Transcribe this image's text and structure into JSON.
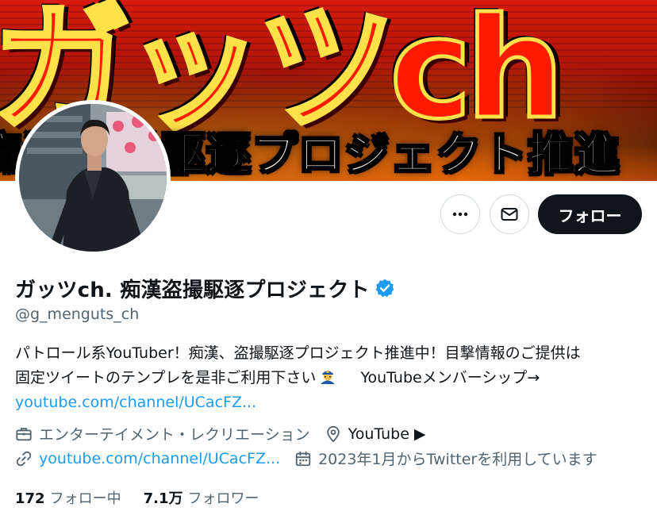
{
  "banner": {
    "headline": "ガッツch",
    "subline": "痴漢盗撮駆逐プロジェクト推進"
  },
  "profile": {
    "display_name": "ガッツch. 痴漢盗撮駆逐プロジェクト",
    "handle": "@g_menguts_ch",
    "verified": true,
    "bio_line1": "パトロール系YouTuber！痴漢、盗撮駆逐プロジェクト推進中！目撃情報のご提供は",
    "bio_line2_pre": "固定ツイートのテンプレを是非ご利用下さい",
    "bio_line2_emoji": "man-police-officer-emoji",
    "bio_line2_post": "YouTubeメンバーシップ→",
    "bio_link": "youtube.com/channel/UCacFZ...",
    "category": "エンターテイメント・レクリエーション",
    "location": "YouTube ▶",
    "website": "youtube.com/channel/UCacFZ...",
    "joined": "2023年1月からTwitterを利用しています",
    "following_count": "172",
    "following_label": "フォロー中",
    "followers_count": "7.1万",
    "followers_label": "フォロワー"
  },
  "actions": {
    "more_icon": "ellipsis-icon",
    "message_icon": "envelope-icon",
    "follow_label": "フォロー"
  },
  "colors": {
    "accent": "#1d9bf0",
    "text_primary": "#0f1419",
    "text_secondary": "#536471",
    "follow_button_bg": "#0f1419"
  }
}
